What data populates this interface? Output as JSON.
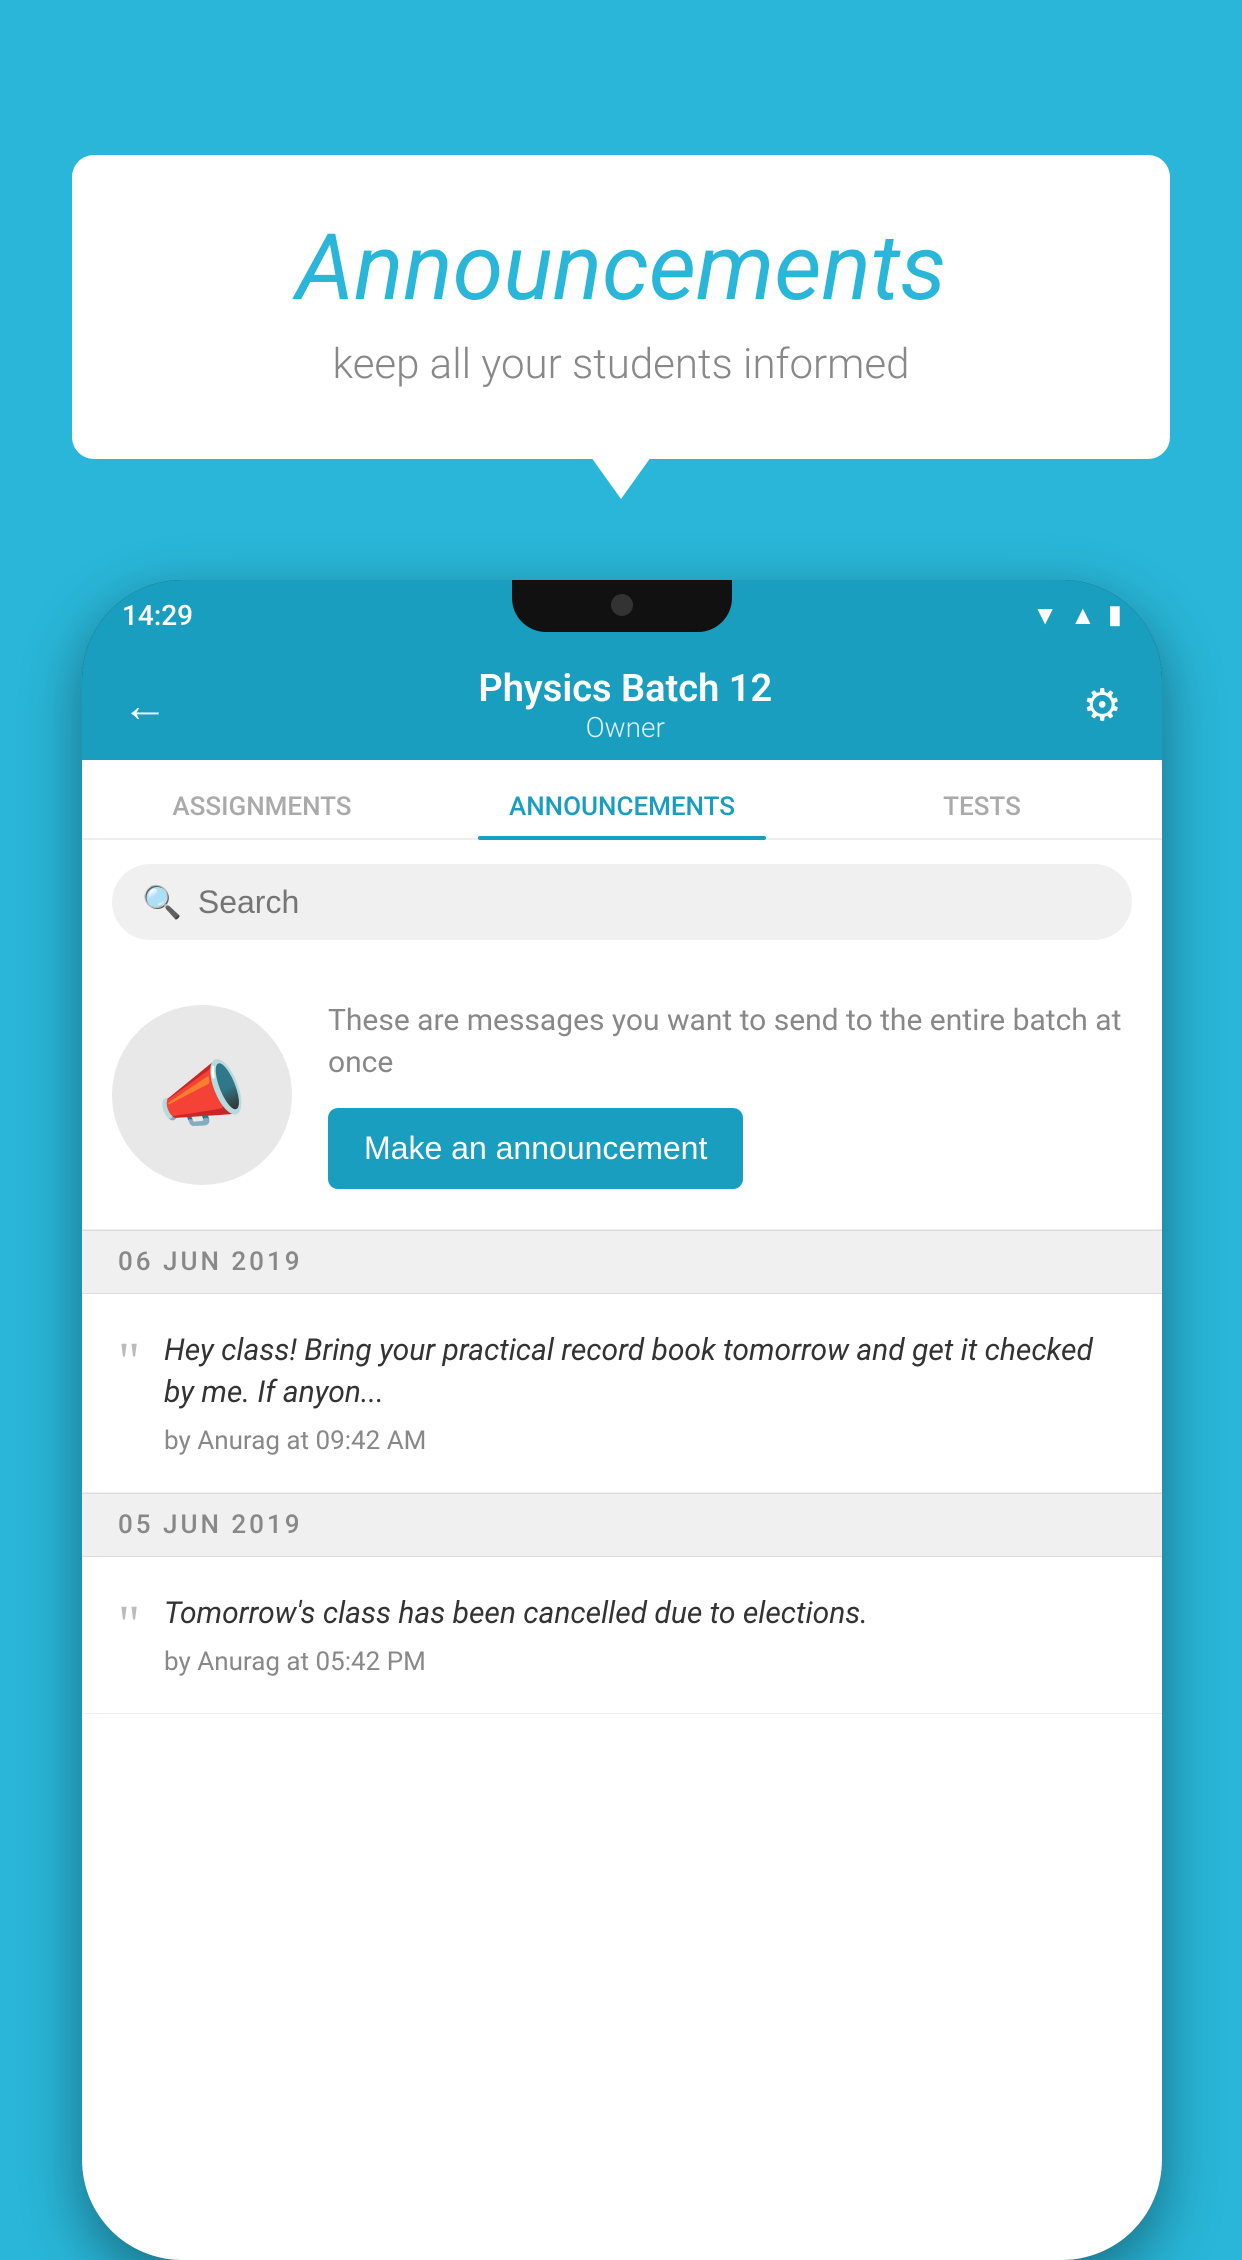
{
  "background_color": "#29B6D8",
  "speech_bubble": {
    "title": "Announcements",
    "subtitle": "keep all your students informed"
  },
  "status_bar": {
    "time": "14:29",
    "icons": [
      "wifi",
      "signal",
      "battery"
    ]
  },
  "app_bar": {
    "back_icon": "←",
    "title": "Physics Batch 12",
    "subtitle": "Owner",
    "gear_icon": "⚙"
  },
  "tabs": [
    {
      "label": "ASSIGNMENTS",
      "active": false
    },
    {
      "label": "ANNOUNCEMENTS",
      "active": true
    },
    {
      "label": "TESTS",
      "active": false
    }
  ],
  "search": {
    "placeholder": "Search"
  },
  "empty_state": {
    "description": "These are messages you want to send to the entire batch at once",
    "button_label": "Make an announcement"
  },
  "announcements": [
    {
      "date": "06  JUN  2019",
      "message": "Hey class! Bring your practical record book tomorrow and get it checked by me. If anyon...",
      "meta": "by Anurag at 09:42 AM"
    },
    {
      "date": "05  JUN  2019",
      "message": "Tomorrow's class has been cancelled due to elections.",
      "meta": "by Anurag at 05:42 PM"
    }
  ]
}
